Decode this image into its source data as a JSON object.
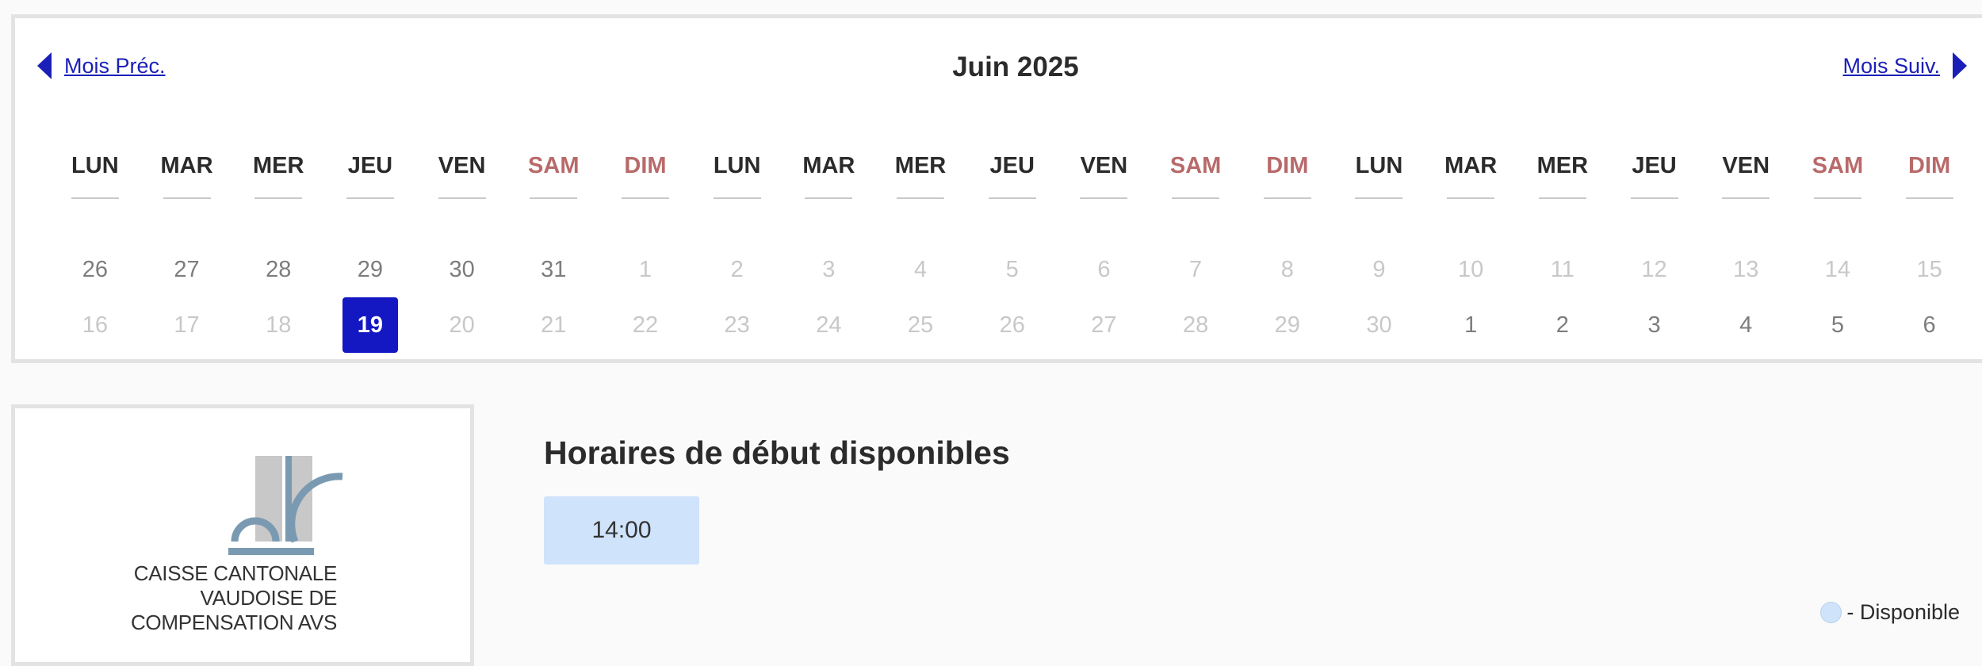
{
  "calendar": {
    "prev_label": "Mois Préc.",
    "next_label": "Mois Suiv.",
    "title": "Juin 2025",
    "weekdays": [
      {
        "label": "LUN",
        "weekend": false
      },
      {
        "label": "MAR",
        "weekend": false
      },
      {
        "label": "MER",
        "weekend": false
      },
      {
        "label": "JEU",
        "weekend": false
      },
      {
        "label": "VEN",
        "weekend": false
      },
      {
        "label": "SAM",
        "weekend": true
      },
      {
        "label": "DIM",
        "weekend": true
      },
      {
        "label": "LUN",
        "weekend": false
      },
      {
        "label": "MAR",
        "weekend": false
      },
      {
        "label": "MER",
        "weekend": false
      },
      {
        "label": "JEU",
        "weekend": false
      },
      {
        "label": "VEN",
        "weekend": false
      },
      {
        "label": "SAM",
        "weekend": true
      },
      {
        "label": "DIM",
        "weekend": true
      },
      {
        "label": "LUN",
        "weekend": false
      },
      {
        "label": "MAR",
        "weekend": false
      },
      {
        "label": "MER",
        "weekend": false
      },
      {
        "label": "JEU",
        "weekend": false
      },
      {
        "label": "VEN",
        "weekend": false
      },
      {
        "label": "SAM",
        "weekend": true
      },
      {
        "label": "DIM",
        "weekend": true
      }
    ],
    "rows": [
      [
        {
          "day": "26",
          "state": "other"
        },
        {
          "day": "27",
          "state": "other"
        },
        {
          "day": "28",
          "state": "other"
        },
        {
          "day": "29",
          "state": "other"
        },
        {
          "day": "30",
          "state": "other"
        },
        {
          "day": "31",
          "state": "other"
        },
        {
          "day": "1",
          "state": "muted"
        },
        {
          "day": "2",
          "state": "muted"
        },
        {
          "day": "3",
          "state": "muted"
        },
        {
          "day": "4",
          "state": "muted"
        },
        {
          "day": "5",
          "state": "muted"
        },
        {
          "day": "6",
          "state": "muted"
        },
        {
          "day": "7",
          "state": "muted"
        },
        {
          "day": "8",
          "state": "muted"
        },
        {
          "day": "9",
          "state": "muted"
        },
        {
          "day": "10",
          "state": "muted"
        },
        {
          "day": "11",
          "state": "muted"
        },
        {
          "day": "12",
          "state": "muted"
        },
        {
          "day": "13",
          "state": "muted"
        },
        {
          "day": "14",
          "state": "muted"
        },
        {
          "day": "15",
          "state": "muted"
        }
      ],
      [
        {
          "day": "16",
          "state": "muted"
        },
        {
          "day": "17",
          "state": "muted"
        },
        {
          "day": "18",
          "state": "muted"
        },
        {
          "day": "19",
          "state": "selected"
        },
        {
          "day": "20",
          "state": "muted"
        },
        {
          "day": "21",
          "state": "muted"
        },
        {
          "day": "22",
          "state": "muted"
        },
        {
          "day": "23",
          "state": "muted"
        },
        {
          "day": "24",
          "state": "muted"
        },
        {
          "day": "25",
          "state": "muted"
        },
        {
          "day": "26",
          "state": "muted"
        },
        {
          "day": "27",
          "state": "muted"
        },
        {
          "day": "28",
          "state": "muted"
        },
        {
          "day": "29",
          "state": "muted"
        },
        {
          "day": "30",
          "state": "muted"
        },
        {
          "day": "1",
          "state": "other"
        },
        {
          "day": "2",
          "state": "other"
        },
        {
          "day": "3",
          "state": "other"
        },
        {
          "day": "4",
          "state": "other"
        },
        {
          "day": "5",
          "state": "other"
        },
        {
          "day": "6",
          "state": "other"
        }
      ]
    ]
  },
  "logo": {
    "lines": [
      "CAISSE CANTONALE",
      "VAUDOISE DE",
      "COMPENSATION AVS"
    ]
  },
  "times": {
    "title": "Horaires de début disponibles",
    "slots": [
      "14:00"
    ]
  },
  "legend": {
    "label": "- Disponible"
  },
  "colors": {
    "accent": "#1418c2",
    "link": "#1a1fb8",
    "weekend": "#b86a6a",
    "available": "#cfe3fb"
  }
}
